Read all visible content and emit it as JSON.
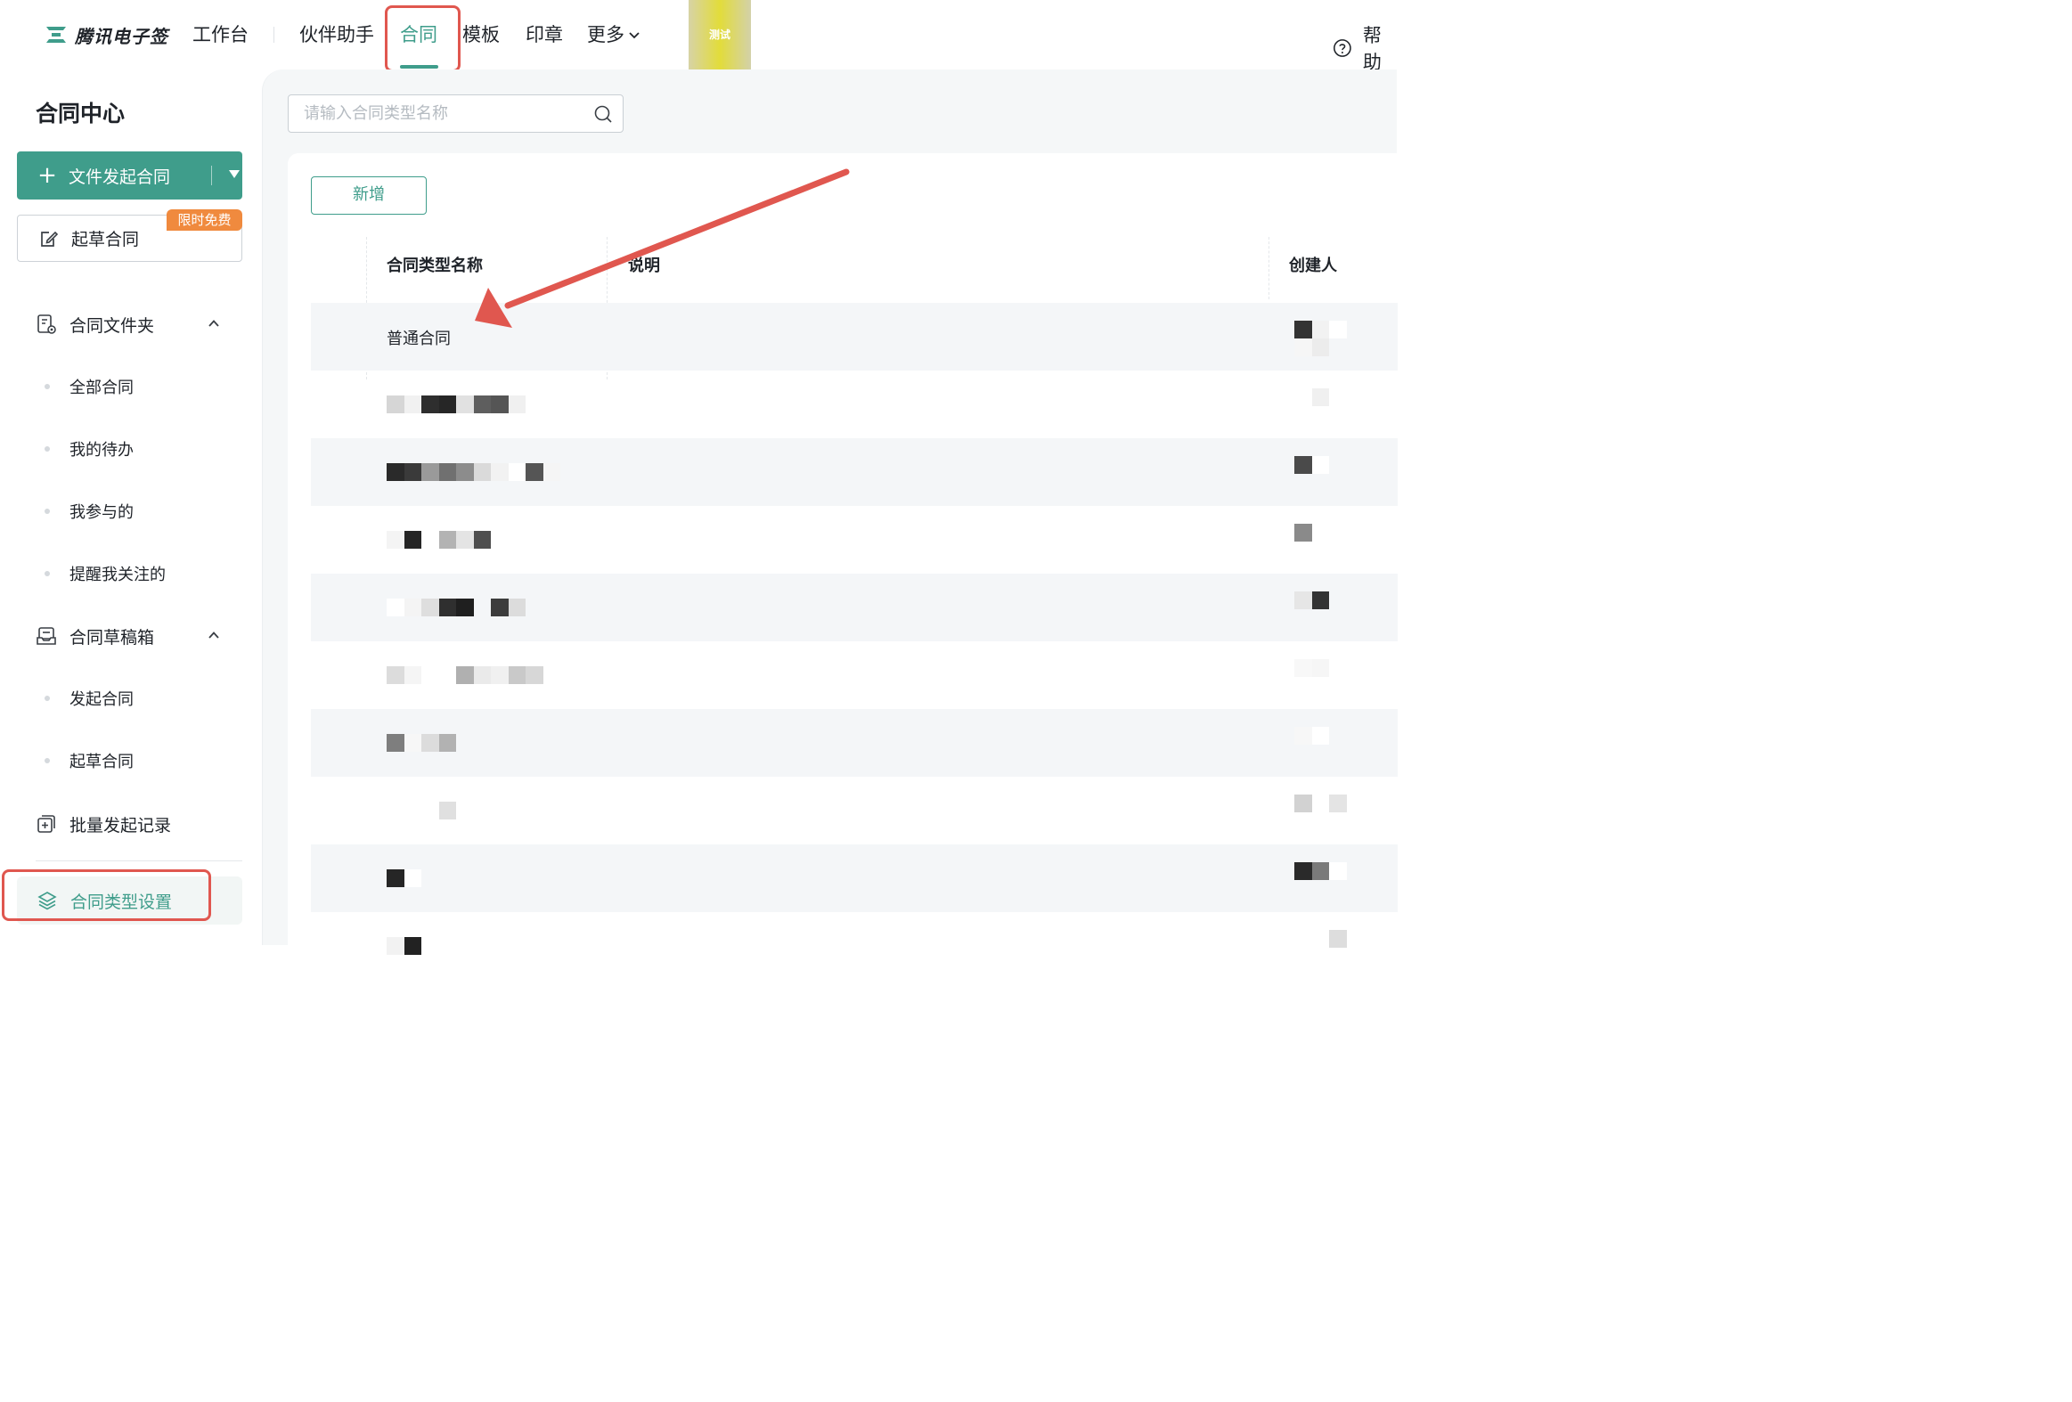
{
  "brand": {
    "name": "腾讯电子签",
    "logo": "tencent-esign-logo-icon"
  },
  "nav": {
    "items": [
      "工作台",
      "伙伴助手",
      "合同",
      "模板",
      "印章",
      "更多"
    ],
    "active": "合同",
    "test_badge": "测试",
    "help": "帮助"
  },
  "sidebar": {
    "title": "合同中心",
    "primary_button": "文件发起合同",
    "draft_button": "起草合同",
    "free_tag": "限时免费",
    "groups": [
      {
        "label": "合同文件夹",
        "icon": "contract-folder-icon",
        "expanded": true,
        "items": [
          "全部合同",
          "我的待办",
          "我参与的",
          "提醒我关注的"
        ]
      },
      {
        "label": "合同草稿箱",
        "icon": "draft-box-icon",
        "expanded": true,
        "items": [
          "发起合同",
          "起草合同"
        ]
      }
    ],
    "batch": {
      "label": "批量发起记录",
      "icon": "batch-icon"
    },
    "selected": {
      "label": "合同类型设置",
      "icon": "layers-icon"
    }
  },
  "main": {
    "search_placeholder": "请输入合同类型名称",
    "add_button": "新增",
    "columns": [
      "合同类型名称",
      "说明",
      "创建人"
    ],
    "rows": [
      {
        "name": "普通合同",
        "description": "",
        "creator": ""
      }
    ]
  },
  "colors": {
    "accent": "#3f9d8b",
    "annotation": "#e0574f",
    "free_tag": "#f08a3e"
  }
}
